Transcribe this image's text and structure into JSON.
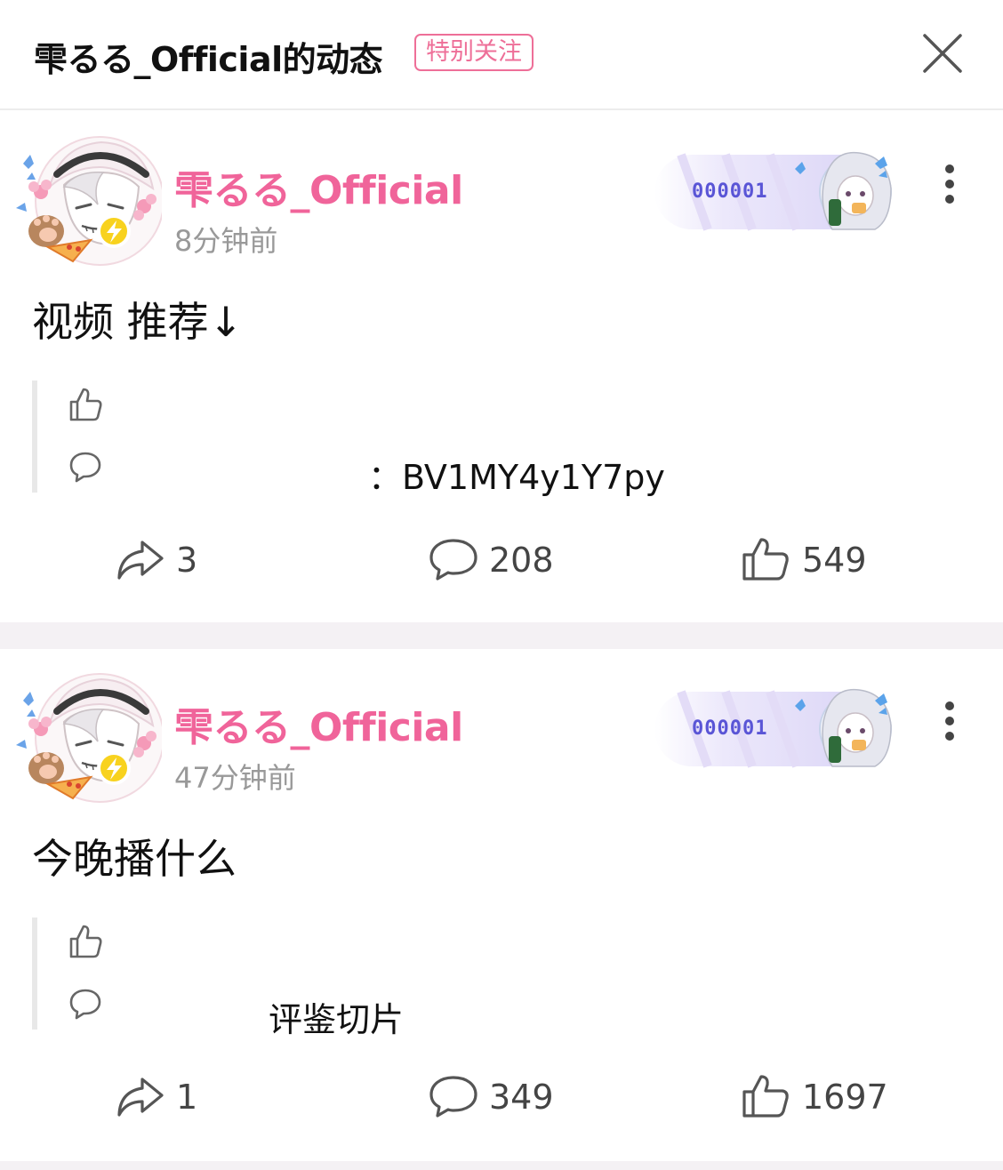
{
  "header": {
    "title": "雫るる_Official的动态",
    "badge": "特别关注",
    "close_icon": "close-icon"
  },
  "colors": {
    "accent_pink": "#f0649a",
    "badge_pink": "#ee6f98",
    "fan_badge_text": "#5a55d6",
    "muted": "#999999"
  },
  "posts": [
    {
      "username": "雫るる_Official",
      "time": "8分钟前",
      "fan_badge": "000001",
      "text": "视频 推荐↓",
      "quote_text": "：BV1MY4y1Y7py",
      "counts": {
        "share": "3",
        "comment": "208",
        "like": "549"
      }
    },
    {
      "username": "雫るる_Official",
      "time": "47分钟前",
      "fan_badge": "000001",
      "text": "今晚播什么",
      "quote_text": "评鉴切片",
      "counts": {
        "share": "1",
        "comment": "349",
        "like": "1697"
      }
    }
  ]
}
